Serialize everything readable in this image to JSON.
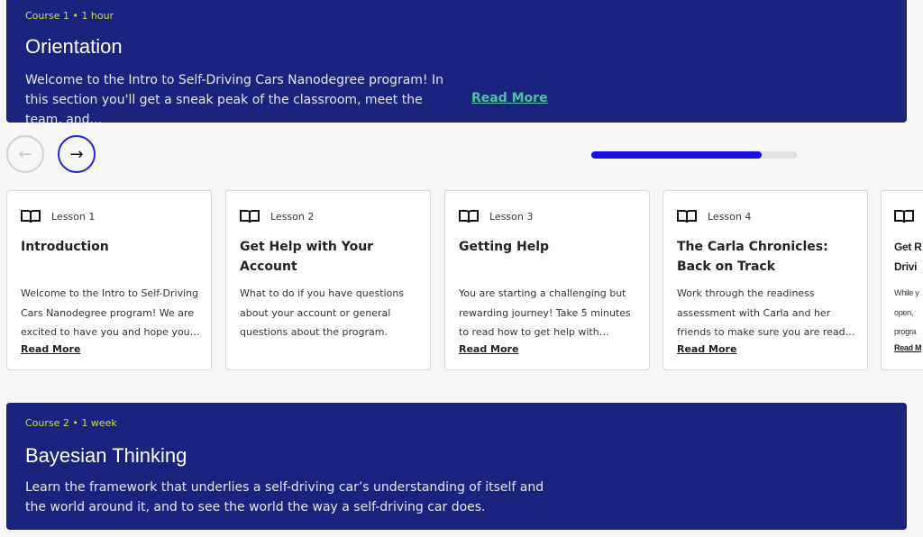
{
  "courses": [
    {
      "meta": "Course 1 • 1 hour",
      "title": "Orientation",
      "description": "Welcome to the Intro to Self-Driving Cars Nanodegree program! In this section you'll get a sneak peak of the classroom, meet the team, and...",
      "read_more": "Read More"
    },
    {
      "meta": "Course 2 • 1 week",
      "title": "Bayesian Thinking",
      "description": "Learn the framework that underlies a self-driving car’s understanding of itself and the world around it, and to see the world the way a self-driving car does."
    }
  ],
  "carousel": {
    "prev_icon": "arrow-left-icon",
    "next_icon": "arrow-right-icon",
    "progress_percent": 83,
    "accent": "#1a0fe6"
  },
  "lessons": [
    {
      "label": "Lesson 1",
      "title": "Introduction",
      "description": "Welcome to the Intro to Self-Driving Cars Nanodegree program! We are excited to have you and hope you are...",
      "read_more": "Read More"
    },
    {
      "label": "Lesson 2",
      "title": "Get Help with Your Account",
      "description": "What to do if you have questions about your account or general questions about the program.",
      "read_more": ""
    },
    {
      "label": "Lesson 3",
      "title": "Getting Help",
      "description": "You are starting a challenging but rewarding journey! Take 5 minutes to read how to get help with projects and...",
      "read_more": "Read More"
    },
    {
      "label": "Lesson 4",
      "title": "The Carla Chronicles: Back on Track",
      "description": "Work through the readiness assessment with Carla and her friends to make sure you are ready to begin...",
      "read_more": "Read More"
    },
    {
      "title_line1": "Get R",
      "title_line2": "Drivi",
      "desc_line1": "While y",
      "desc_line2": "open,",
      "desc_line3": "progra",
      "read_more": "Read M"
    }
  ],
  "colors": {
    "course_bg": "#1a237e",
    "meta": "#c6e04a",
    "read_more": "#4fc3a1"
  }
}
